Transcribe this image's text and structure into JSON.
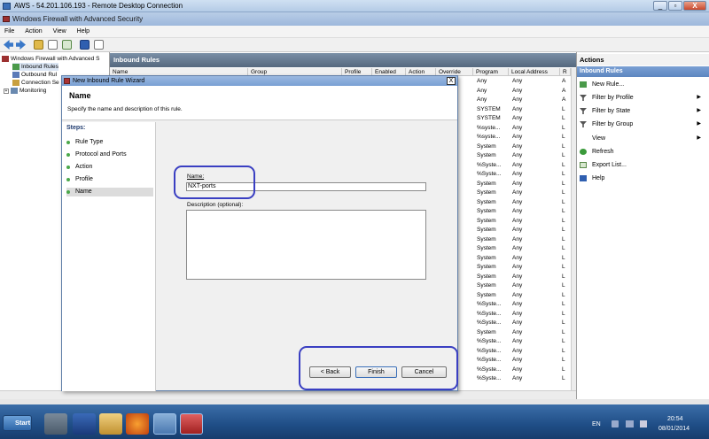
{
  "rdp": {
    "title": "AWS - 54.201.106.193 - Remote Desktop Connection",
    "minimize": "_",
    "restore": "▫",
    "close": "X"
  },
  "app": {
    "title": "Windows Firewall with Advanced Security"
  },
  "menu": [
    "File",
    "Action",
    "View",
    "Help"
  ],
  "tree": {
    "root": "Windows Firewall with Advanced S",
    "items": [
      "Inbound Rules",
      "Outbound Rul",
      "Connection Se",
      "Monitoring"
    ]
  },
  "inbound": {
    "title": "Inbound Rules",
    "columns": [
      "Name",
      "Group",
      "Profile",
      "Enabled",
      "Action",
      "Override",
      "Program",
      "Local Address",
      "R"
    ],
    "program_col": [
      "Any",
      "Any",
      "Any",
      "SYSTEM",
      "SYSTEM",
      "%syste...",
      "%syste...",
      "System",
      "System",
      "%Syste...",
      "%Syste...",
      "System",
      "System",
      "System",
      "System",
      "System",
      "System",
      "System",
      "System",
      "System",
      "System",
      "System",
      "System",
      "System",
      "%Syste...",
      "%Syste...",
      "%Syste...",
      "System",
      "%Syste...",
      "%Syste...",
      "%Syste...",
      "%Syste...",
      "%Syste..."
    ],
    "local_col": [
      "Any",
      "Any",
      "Any",
      "Any",
      "Any",
      "Any",
      "Any",
      "Any",
      "Any",
      "Any",
      "Any",
      "Any",
      "Any",
      "Any",
      "Any",
      "Any",
      "Any",
      "Any",
      "Any",
      "Any",
      "Any",
      "Any",
      "Any",
      "Any",
      "Any",
      "Any",
      "Any",
      "Any",
      "Any",
      "Any",
      "Any",
      "Any",
      "Any"
    ],
    "r_col": [
      "A",
      "A",
      "A",
      "L",
      "L",
      "L",
      "L",
      "L",
      "L",
      "L",
      "L",
      "L",
      "L",
      "L",
      "L",
      "L",
      "L",
      "L",
      "L",
      "L",
      "L",
      "L",
      "L",
      "L",
      "L",
      "L",
      "L",
      "L",
      "L",
      "L",
      "L",
      "L",
      "L"
    ]
  },
  "actions": {
    "title": "Actions",
    "section": "Inbound Rules",
    "items": [
      {
        "label": "New Rule...",
        "icon": "new-rule-icon",
        "arrow": ""
      },
      {
        "label": "Filter by Profile",
        "icon": "filter-icon",
        "arrow": "▶"
      },
      {
        "label": "Filter by State",
        "icon": "filter-icon",
        "arrow": "▶"
      },
      {
        "label": "Filter by Group",
        "icon": "filter-icon",
        "arrow": "▶"
      },
      {
        "label": "View",
        "icon": "",
        "arrow": "▶"
      },
      {
        "label": "Refresh",
        "icon": "refresh-icon",
        "arrow": ""
      },
      {
        "label": "Export List...",
        "icon": "export-icon",
        "arrow": ""
      },
      {
        "label": "Help",
        "icon": "help-icon",
        "arrow": ""
      }
    ]
  },
  "wizard": {
    "title": "New Inbound Rule Wizard",
    "heading": "Name",
    "subheading": "Specify the name and description of this rule.",
    "steps_label": "Steps:",
    "steps": [
      "Rule Type",
      "Protocol and Ports",
      "Action",
      "Profile",
      "Name"
    ],
    "name_label": "Name:",
    "name_value": "NXT-ports",
    "description_label": "Description (optional):",
    "description_value": "",
    "back": "< Back",
    "finish": "Finish",
    "cancel": "Cancel",
    "close": "X"
  },
  "taskbar": {
    "start": "Start",
    "lang": "EN",
    "time": "20:54",
    "date": "08/01/2014"
  },
  "colors": {
    "annotation_ring": "#3a3fc2",
    "header_bar": "#55687e",
    "actions_bar": "#5d86c0"
  }
}
